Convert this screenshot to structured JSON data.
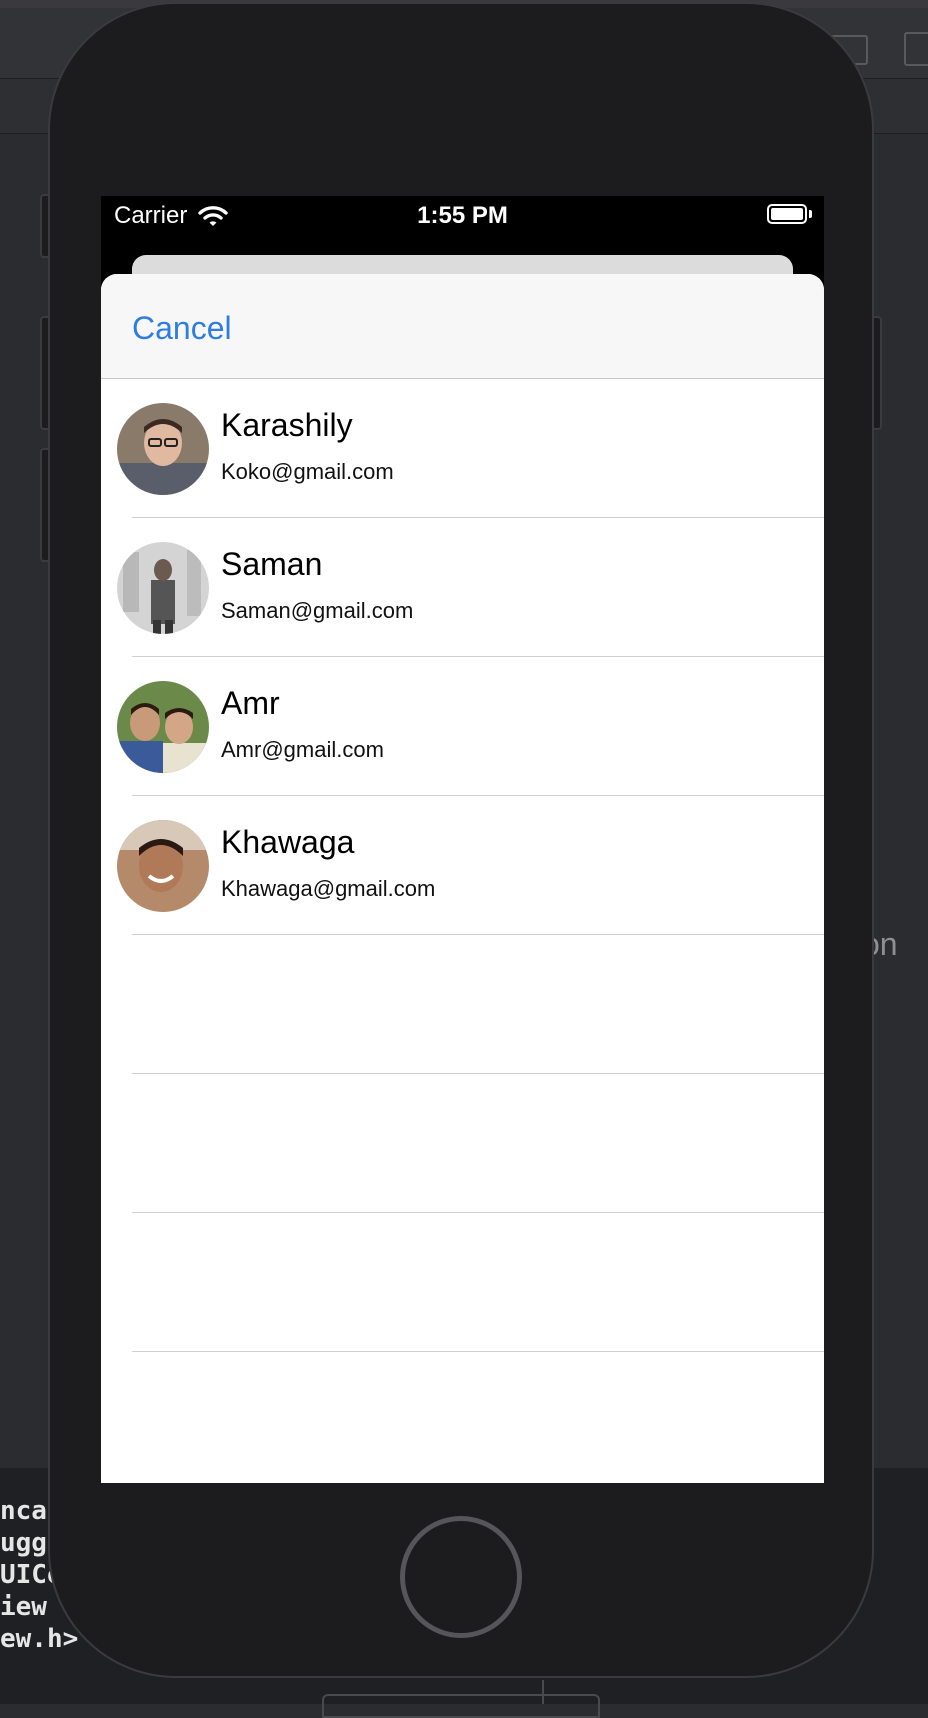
{
  "status_bar": {
    "carrier": "Carrier",
    "time": "1:55 PM"
  },
  "nav": {
    "cancel_label": "Cancel"
  },
  "contacts": [
    {
      "name": "Karashily",
      "email": "Koko@gmail.com"
    },
    {
      "name": "Saman",
      "email": "Saman@gmail.com"
    },
    {
      "name": "Amr",
      "email": "Amr@gmail.com"
    },
    {
      "name": "Khawaga",
      "email": "Khawaga@gmail.com"
    }
  ],
  "background": {
    "console_lines": [
      "ncat",
      "ugge",
      "UICo",
      "iew l",
      "ew.h> m"
    ],
    "side_text": "on"
  },
  "colors": {
    "accent": "#2e7de1",
    "separator": "#cfcfd4"
  }
}
